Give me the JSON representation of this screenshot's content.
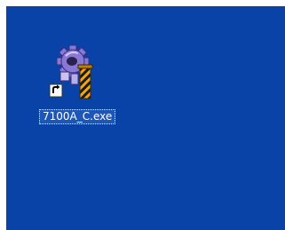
{
  "desktop": {
    "background_color": "#0a43a8",
    "icons": [
      {
        "label": "7100A_C.exe",
        "icon": "gear-wrench-shortcut-icon",
        "selected": true
      }
    ]
  }
}
